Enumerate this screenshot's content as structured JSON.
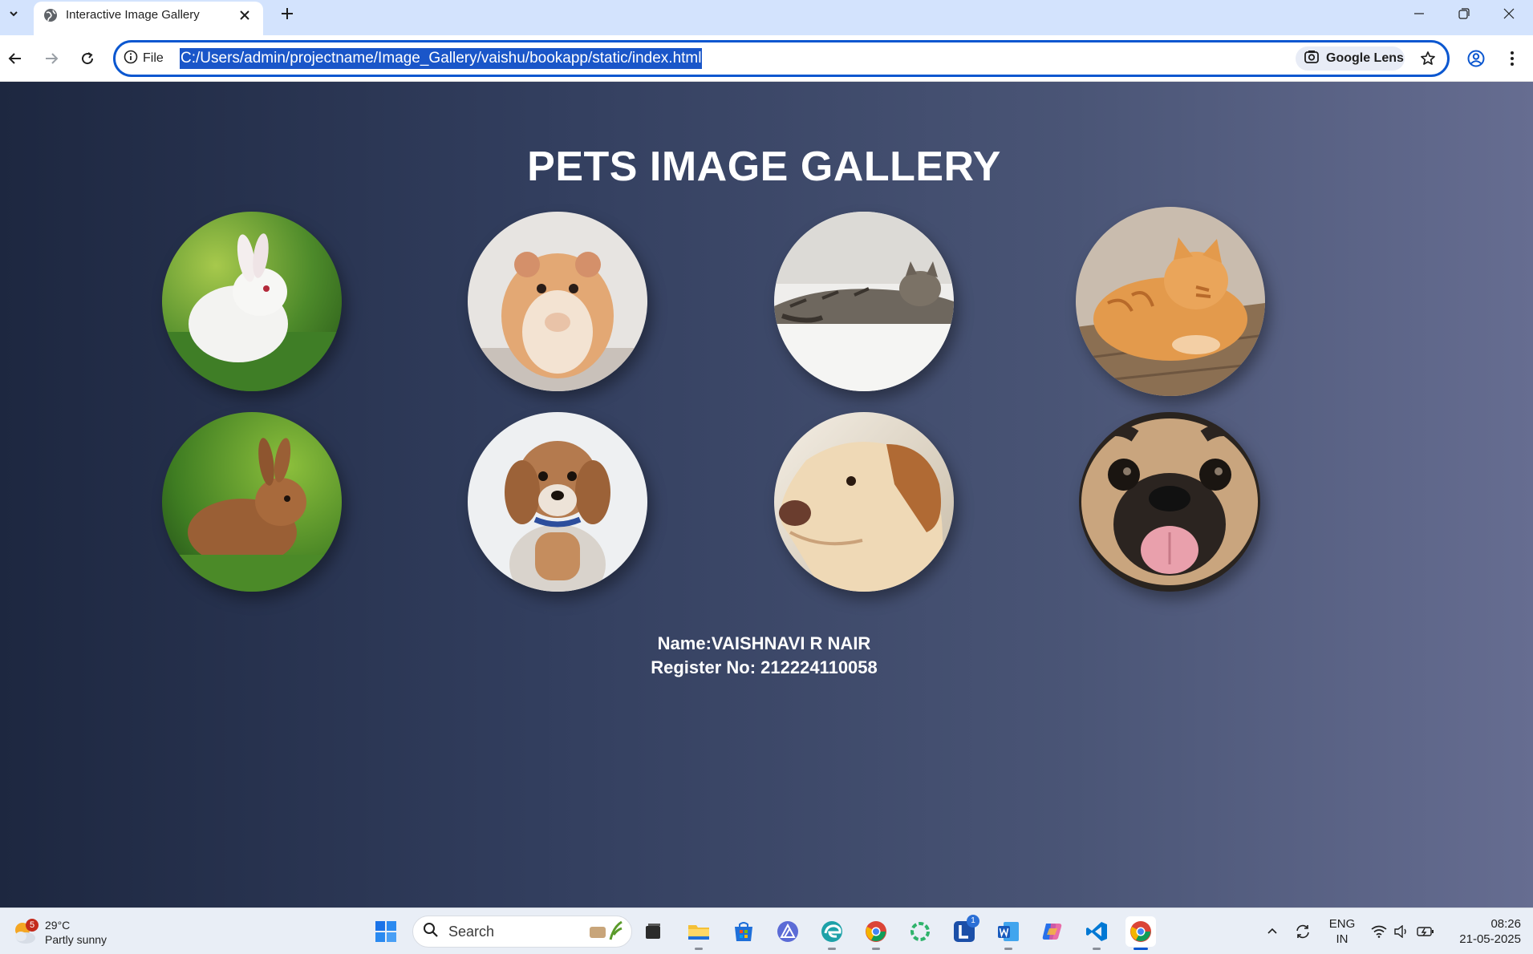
{
  "browser": {
    "tab_title": "Interactive Image Gallery",
    "site_label": "File",
    "url": "C:/Users/admin/projectname/Image_Gallery/vaishu/bookapp/static/index.html",
    "lens_label": "Google Lens"
  },
  "page": {
    "title": "PETS IMAGE GALLERY",
    "pets": [
      {
        "name": "white-rabbit",
        "description": "white rabbit on grass"
      },
      {
        "name": "hamster",
        "description": "hamster"
      },
      {
        "name": "tabby-cat",
        "description": "tabby cat lying"
      },
      {
        "name": "orange-cat",
        "description": "orange cat"
      },
      {
        "name": "brown-rabbit",
        "description": "brown rabbit on grass"
      },
      {
        "name": "fluffy-dog",
        "description": "fluffy dog with collar"
      },
      {
        "name": "labrador",
        "description": "labrador dog"
      },
      {
        "name": "pug",
        "description": "pug with tongue out"
      }
    ],
    "name_line": "Name:VAISHNAVI R NAIR",
    "register_line": "Register No: 212224110058"
  },
  "taskbar": {
    "weather_temp": "29°C",
    "weather_desc": "Partly sunny",
    "weather_badge": "5",
    "search_label": "Search",
    "lang_line1": "ENG",
    "lang_line2": "IN",
    "time": "08:26",
    "date": "21-05-2025",
    "notification_count": "1"
  }
}
